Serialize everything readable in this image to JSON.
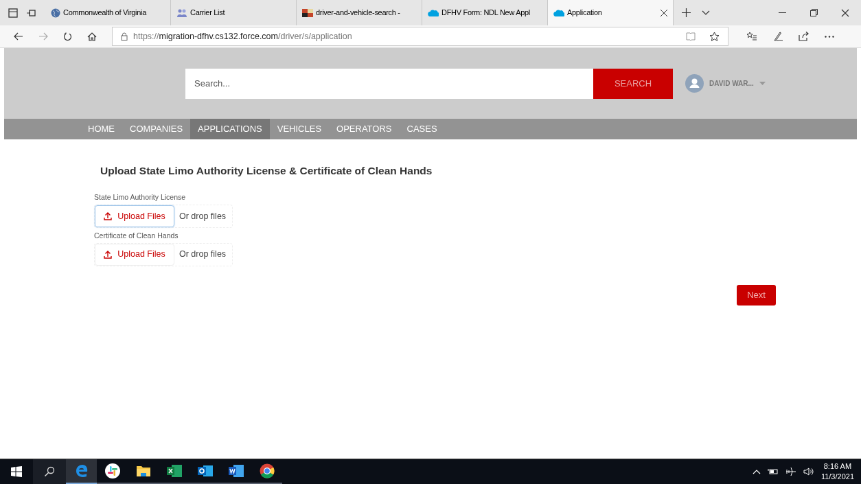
{
  "browser": {
    "tabs": [
      {
        "title": "Commonwealth of Virginia",
        "kind": "globe",
        "selected": false
      },
      {
        "title": "Carrier List",
        "kind": "people",
        "selected": false
      },
      {
        "title": "driver-and-vehicle-search -",
        "kind": "flag",
        "selected": false
      },
      {
        "title": "DFHV Form: NDL New Appl",
        "kind": "cloud",
        "selected": false
      },
      {
        "title": "Application",
        "kind": "cloud",
        "selected": true
      }
    ],
    "url": {
      "scheme": "https://",
      "host": "migration-dfhv.cs132.force.com",
      "path": "/driver/s/application"
    }
  },
  "header": {
    "search_placeholder": "Search...",
    "search_button": "SEARCH",
    "user": "DAVID WAR..."
  },
  "nav": [
    {
      "label": "HOME",
      "selected": false
    },
    {
      "label": "COMPANIES",
      "selected": false
    },
    {
      "label": "APPLICATIONS",
      "selected": true
    },
    {
      "label": "VEHICLES",
      "selected": false
    },
    {
      "label": "OPERATORS",
      "selected": false
    },
    {
      "label": "CASES",
      "selected": false
    }
  ],
  "page": {
    "title": "Upload State Limo Authority License & Certificate of Clean Hands",
    "uploads": [
      {
        "label": "State Limo Authority License",
        "button": "Upload Files",
        "drop": "Or drop files",
        "focused": true
      },
      {
        "label": "Certificate of Clean Hands",
        "button": "Upload Files",
        "drop": "Or drop files",
        "focused": false
      }
    ],
    "next_button": "Next"
  },
  "taskbar": {
    "apps": [
      {
        "kind": "edge",
        "selected": true
      },
      {
        "kind": "slack",
        "selected": false
      },
      {
        "kind": "folder",
        "selected": false
      },
      {
        "kind": "excel",
        "selected": false
      },
      {
        "kind": "outlook",
        "selected": false
      },
      {
        "kind": "word",
        "selected": false
      },
      {
        "kind": "chrome",
        "selected": false
      }
    ],
    "time": "8:16 AM",
    "date": "11/3/2021"
  }
}
